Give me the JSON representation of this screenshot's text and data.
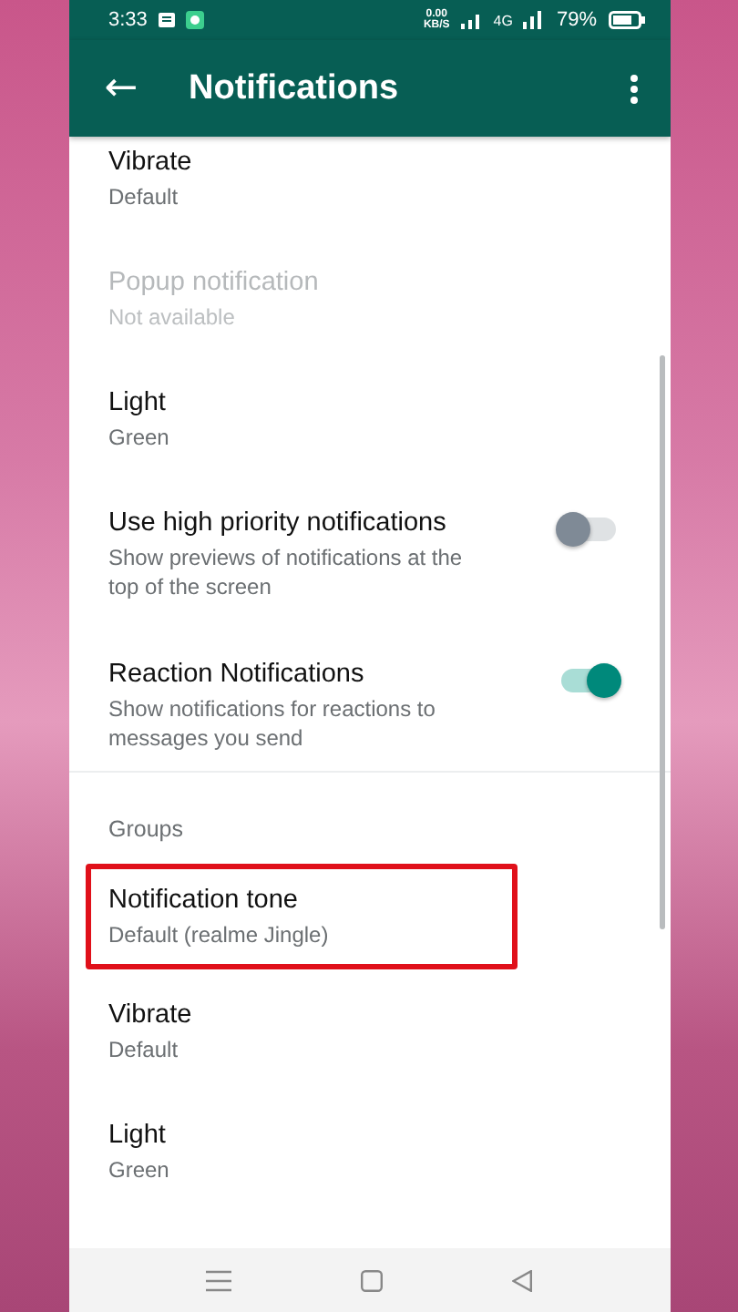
{
  "status_bar": {
    "time": "3:33",
    "net_speed": "0.00",
    "net_unit": "KB/S",
    "network": "4G",
    "battery": "79%"
  },
  "app_bar": {
    "back": "←",
    "title": "Notifications"
  },
  "items": [
    {
      "kind": "setting",
      "title": "Vibrate",
      "subtitle": "Default",
      "disabled": false,
      "highlighted": false
    },
    {
      "kind": "setting",
      "title": "Popup notification",
      "subtitle": "Not available",
      "disabled": true,
      "highlighted": false
    },
    {
      "kind": "setting",
      "title": "Light",
      "subtitle": "Green",
      "disabled": false,
      "highlighted": false
    },
    {
      "kind": "toggle",
      "title": "Use high priority notifications",
      "subtitle": "Show previews of notifications at the top of the screen",
      "on": false
    },
    {
      "kind": "toggle",
      "title": "Reaction Notifications",
      "subtitle": "Show notifications for reactions to messages you send",
      "on": true
    },
    {
      "kind": "header",
      "title": "Groups"
    },
    {
      "kind": "setting",
      "title": "Notification tone",
      "subtitle": "Default (realme Jingle)",
      "disabled": false,
      "highlighted": true
    },
    {
      "kind": "setting",
      "title": "Vibrate",
      "subtitle": "Default",
      "disabled": false,
      "highlighted": false
    },
    {
      "kind": "setting",
      "title": "Light",
      "subtitle": "Green",
      "disabled": false,
      "highlighted": false
    }
  ]
}
